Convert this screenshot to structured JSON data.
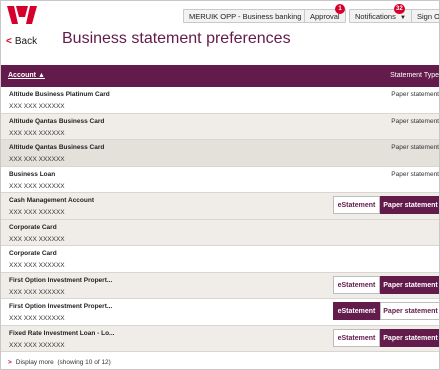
{
  "colors": {
    "brand": "#d5002b",
    "accent": "#621b4b"
  },
  "topbar": {
    "logo_icon": "westpac-w-logo",
    "account_selector": "MERUIK OPP - Business banking",
    "approval": {
      "label": "Approval",
      "count": "1"
    },
    "notifications": {
      "label": "Notifications",
      "count": "32"
    },
    "sign_out": "Sign Out"
  },
  "header": {
    "back": "Back",
    "title": "Business statement preferences"
  },
  "table": {
    "col_account": "Account",
    "col_type": "Statement Type",
    "rows": [
      {
        "name": "Altitude Business Platinum Card",
        "number": "XXX XXX XXXXXX",
        "type": "Paper statement"
      },
      {
        "name": "Altitude Qantas Business Card",
        "number": "XXX XXX XXXXXX",
        "type": "Paper statement"
      },
      {
        "name": "Altitude Qantas Business Card",
        "number": "XXX XXX XXXXXX",
        "type": "Paper statement"
      },
      {
        "name": "Business Loan",
        "number": "XXX XXX XXXXXX",
        "type": "Paper statement"
      },
      {
        "name": "Cash Management Account",
        "number": "XXX XXX XXXXXX",
        "estatement": "eStatement",
        "paper": "Paper statement",
        "selected": "paper"
      },
      {
        "name": "Corporate Card",
        "number": "XXX XXX XXXXXX"
      },
      {
        "name": "Corporate Card",
        "number": "XXX XXX XXXXXX"
      },
      {
        "name": "First Option Investment Propert...",
        "number": "XXX XXX XXXXXX",
        "estatement": "eStatement",
        "paper": "Paper statement",
        "selected": "paper"
      },
      {
        "name": "First Option Investment Propert...",
        "number": "XXX XXX XXXXXX",
        "estatement": "eStatement",
        "paper": "Paper statement",
        "selected": "estatement"
      },
      {
        "name": "Fixed Rate Investment Loan - Lo...",
        "number": "XXX XXX XXXXXX",
        "estatement": "eStatement",
        "paper": "Paper statement",
        "selected": "paper"
      }
    ]
  },
  "footer": {
    "display_more": "Display more",
    "showing": "(showing 10 of 12)"
  }
}
